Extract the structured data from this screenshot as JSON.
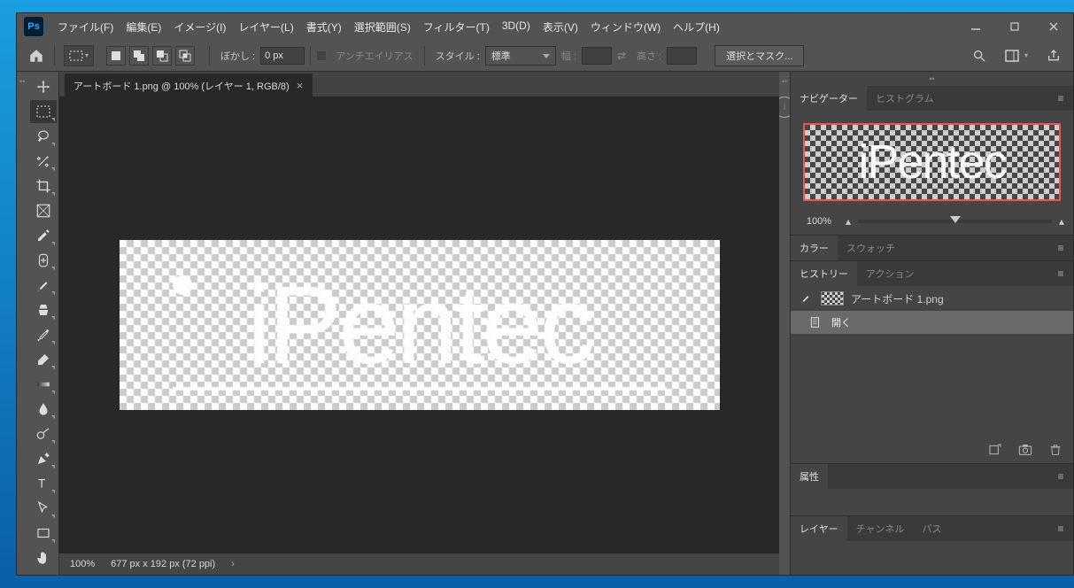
{
  "menu": {
    "file": "ファイル(F)",
    "edit": "編集(E)",
    "image": "イメージ(I)",
    "layer": "レイヤー(L)",
    "type": "書式(Y)",
    "select": "選択範囲(S)",
    "filter": "フィルター(T)",
    "threeD": "3D(D)",
    "view": "表示(V)",
    "window": "ウィンドウ(W)",
    "help": "ヘルプ(H)"
  },
  "optbar": {
    "feather_label": "ぼかし :",
    "feather_value": "0 px",
    "antialias": "アンチエイリアス",
    "style_label": "スタイル :",
    "style_value": "標準",
    "width_label": "幅 :",
    "width_value": "",
    "height_label": "高さ :",
    "height_value": "",
    "select_mask": "選択とマスク..."
  },
  "tab": {
    "title": "アートボード 1.png @ 100% (レイヤー 1, RGB/8)"
  },
  "canvas_text": "iPentec",
  "status": {
    "zoom": "100%",
    "dims": "677 px x 192 px (72 ppi)"
  },
  "nav": {
    "navigator": "ナビゲーター",
    "histogram": "ヒストグラム",
    "zoom": "100%"
  },
  "color": {
    "color": "カラー",
    "swatch": "スウォッチ"
  },
  "history": {
    "history": "ヒストリー",
    "action": "アクション",
    "source_name": "アートボード 1.png",
    "step1": "開く"
  },
  "props": {
    "properties": "属性"
  },
  "layers": {
    "layers": "レイヤー",
    "channels": "チャンネル",
    "paths": "パス"
  }
}
